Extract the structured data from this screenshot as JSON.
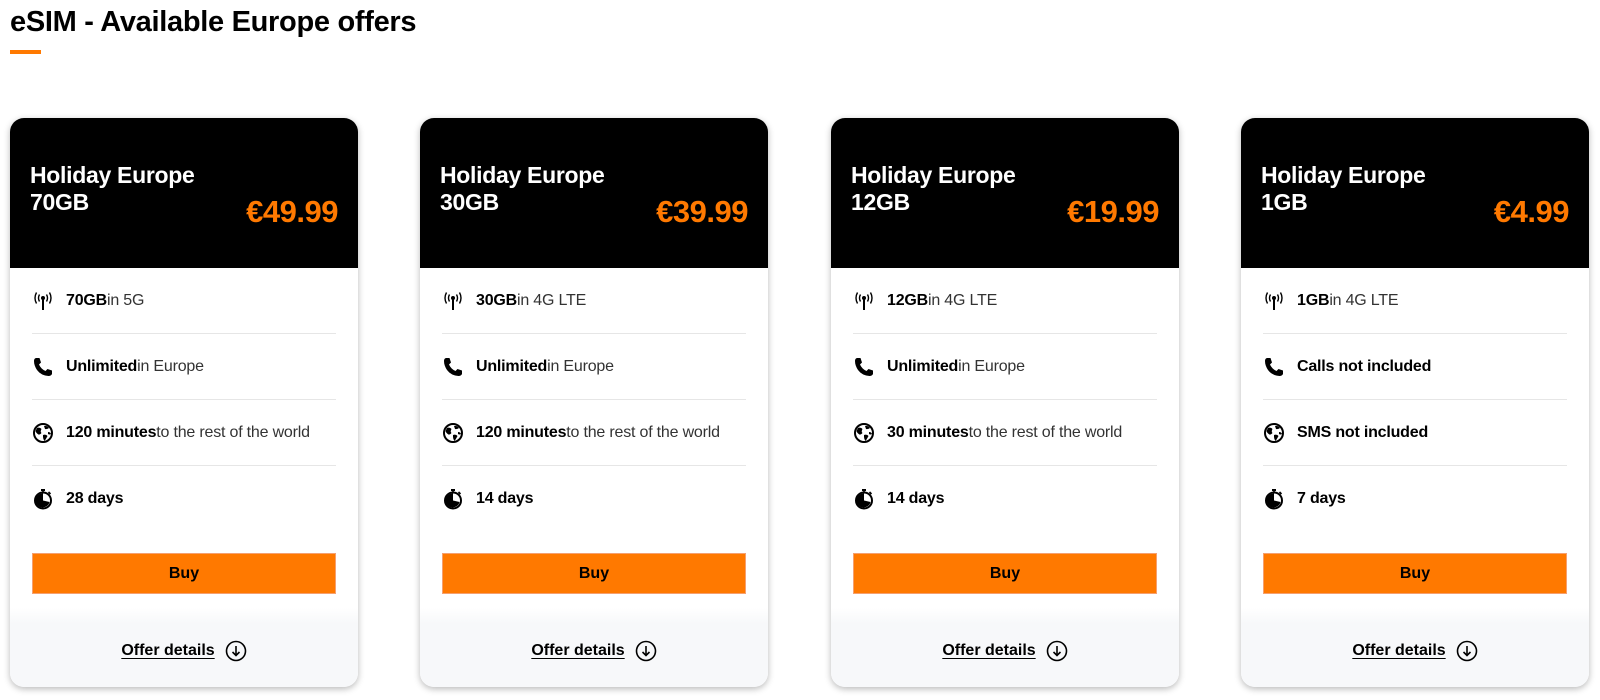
{
  "page": {
    "title": "eSIM - Available Europe offers",
    "accent_color": "#ff7900"
  },
  "offers": [
    {
      "name_line1": "Holiday Europe",
      "name_line2": "70GB",
      "price": "€49.99",
      "features": [
        {
          "icon": "signal-antenna-icon",
          "bold": "70GB",
          "rest": " in 5G"
        },
        {
          "icon": "phone-icon",
          "bold": "Unlimited",
          "rest": " in Europe"
        },
        {
          "icon": "globe-icon",
          "bold": "120 minutes",
          "rest": " to the rest of the world"
        },
        {
          "icon": "stopwatch-icon",
          "bold": "28 days",
          "rest": ""
        }
      ],
      "buy_label": "Buy",
      "details_label": "Offer details"
    },
    {
      "name_line1": "Holiday Europe",
      "name_line2": "30GB",
      "price": "€39.99",
      "features": [
        {
          "icon": "signal-antenna-icon",
          "bold": "30GB",
          "rest": " in 4G LTE"
        },
        {
          "icon": "phone-icon",
          "bold": "Unlimited",
          "rest": " in Europe"
        },
        {
          "icon": "globe-icon",
          "bold": "120 minutes",
          "rest": " to the rest of the world"
        },
        {
          "icon": "stopwatch-icon",
          "bold": "14 days",
          "rest": ""
        }
      ],
      "buy_label": "Buy",
      "details_label": "Offer details"
    },
    {
      "name_line1": "Holiday Europe",
      "name_line2": "12GB",
      "price": "€19.99",
      "features": [
        {
          "icon": "signal-antenna-icon",
          "bold": "12GB",
          "rest": " in 4G LTE"
        },
        {
          "icon": "phone-icon",
          "bold": "Unlimited",
          "rest": " in Europe"
        },
        {
          "icon": "globe-icon",
          "bold": "30 minutes",
          "rest": " to the rest of the world"
        },
        {
          "icon": "stopwatch-icon",
          "bold": "14 days",
          "rest": ""
        }
      ],
      "buy_label": "Buy",
      "details_label": "Offer details"
    },
    {
      "name_line1": "Holiday Europe",
      "name_line2": "1GB",
      "price": "€4.99",
      "features": [
        {
          "icon": "signal-antenna-icon",
          "bold": "1GB",
          "rest": " in 4G LTE"
        },
        {
          "icon": "phone-icon",
          "bold": "Calls not included",
          "rest": ""
        },
        {
          "icon": "globe-icon",
          "bold": "SMS not included",
          "rest": ""
        },
        {
          "icon": "stopwatch-icon",
          "bold": "7 days",
          "rest": ""
        }
      ],
      "buy_label": "Buy",
      "details_label": "Offer details"
    }
  ]
}
